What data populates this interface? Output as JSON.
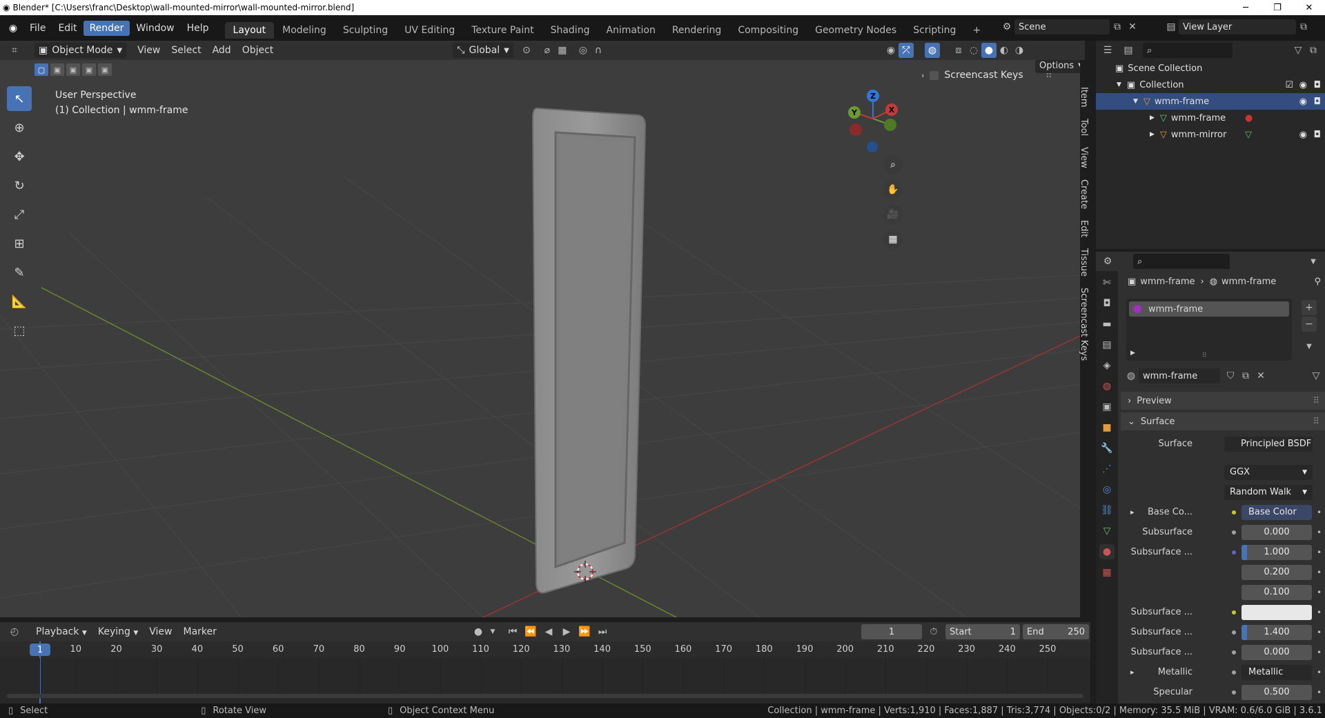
{
  "titlebar": {
    "text": "Blender* [C:\\Users\\franc\\Desktop\\wall-mounted-mirror\\wall-mounted-mirror.blend]",
    "min": "─",
    "max": "❐",
    "close": "✕"
  },
  "menu": [
    "File",
    "Edit",
    "Render",
    "Window",
    "Help"
  ],
  "workspaces": [
    "Layout",
    "Modeling",
    "Sculpting",
    "UV Editing",
    "Texture Paint",
    "Shading",
    "Animation",
    "Rendering",
    "Compositing",
    "Geometry Nodes",
    "Scripting"
  ],
  "add_workspace": "+",
  "scene": {
    "label": "Scene",
    "view_layer": "View Layer"
  },
  "viewport_header": {
    "mode": "Object Mode",
    "menus": [
      "View",
      "Select",
      "Add",
      "Object"
    ],
    "transform": "Global",
    "options": "Options"
  },
  "viewport": {
    "perspective": "User Perspective",
    "context": "(1) Collection | wmm-frame",
    "screencast_keys": "Screencast Keys",
    "gizmo": {
      "z": "Z",
      "x": "X",
      "y": "Y"
    }
  },
  "side_tabs": [
    "Item",
    "Tool",
    "View",
    "Create",
    "Edit",
    "Tissue",
    "Screencast Keys"
  ],
  "timeline": {
    "menus": [
      "Playback",
      "Keying",
      "View",
      "Marker"
    ],
    "current_frame": "1",
    "start_label": "Start",
    "start": "1",
    "end_label": "End",
    "end": "250",
    "ticks": [
      "1",
      "10",
      "20",
      "30",
      "40",
      "50",
      "60",
      "70",
      "80",
      "90",
      "100",
      "110",
      "120",
      "130",
      "140",
      "150",
      "160",
      "170",
      "180",
      "190",
      "200",
      "210",
      "220",
      "230",
      "240",
      "250"
    ]
  },
  "statusbar": {
    "select": "Select",
    "rotate": "Rotate View",
    "context_menu": "Object Context Menu",
    "stats": "Collection | wmm-frame | Verts:1,910 | Faces:1,887 | Tris:3,774 | Objects:0/2 | Memory: 35.5 MiB | VRAM: 0.6/6.0 GiB | 3.6.1"
  },
  "outliner": {
    "scene_collection": "Scene Collection",
    "collection": "Collection",
    "items": [
      "wmm-frame",
      "wmm-frame",
      "wmm-mirror"
    ]
  },
  "properties": {
    "breadcrumb_object": "wmm-frame",
    "breadcrumb_material": "wmm-frame",
    "slot": "wmm-frame",
    "material_name": "wmm-frame",
    "panels": {
      "preview": "Preview",
      "surface": "Surface"
    },
    "surface_label": "Surface",
    "surface_value": "Principled BSDF",
    "distribution": "GGX",
    "subsurface_method": "Random Walk",
    "rows": [
      {
        "label": "Base Co...",
        "value": "Base Color",
        "dot": "#c7c729"
      },
      {
        "label": "Subsurface",
        "value": "0.000",
        "dot": "#a1a1a1"
      },
      {
        "label": "Subsurface ...",
        "value": "1.000",
        "dot": "#6363c7"
      },
      {
        "label": "",
        "value": "0.200",
        "dot": ""
      },
      {
        "label": "",
        "value": "0.100",
        "dot": ""
      },
      {
        "label": "Subsurface ...",
        "value": "",
        "dot": "#c7c729"
      },
      {
        "label": "Subsurface ...",
        "value": "1.400",
        "dot": "#a1a1a1"
      },
      {
        "label": "Subsurface ...",
        "value": "0.000",
        "dot": "#a1a1a1"
      },
      {
        "label": "Metallic",
        "value": "Metallic",
        "dot": "#a1a1a1"
      },
      {
        "label": "Specular",
        "value": "0.500",
        "dot": "#a1a1a1"
      }
    ]
  },
  "colors": {
    "accent": "#4772b3",
    "axis_x": "#c23b3b",
    "axis_y": "#6b9b2e",
    "gizmo_z": "#2f78d6"
  }
}
